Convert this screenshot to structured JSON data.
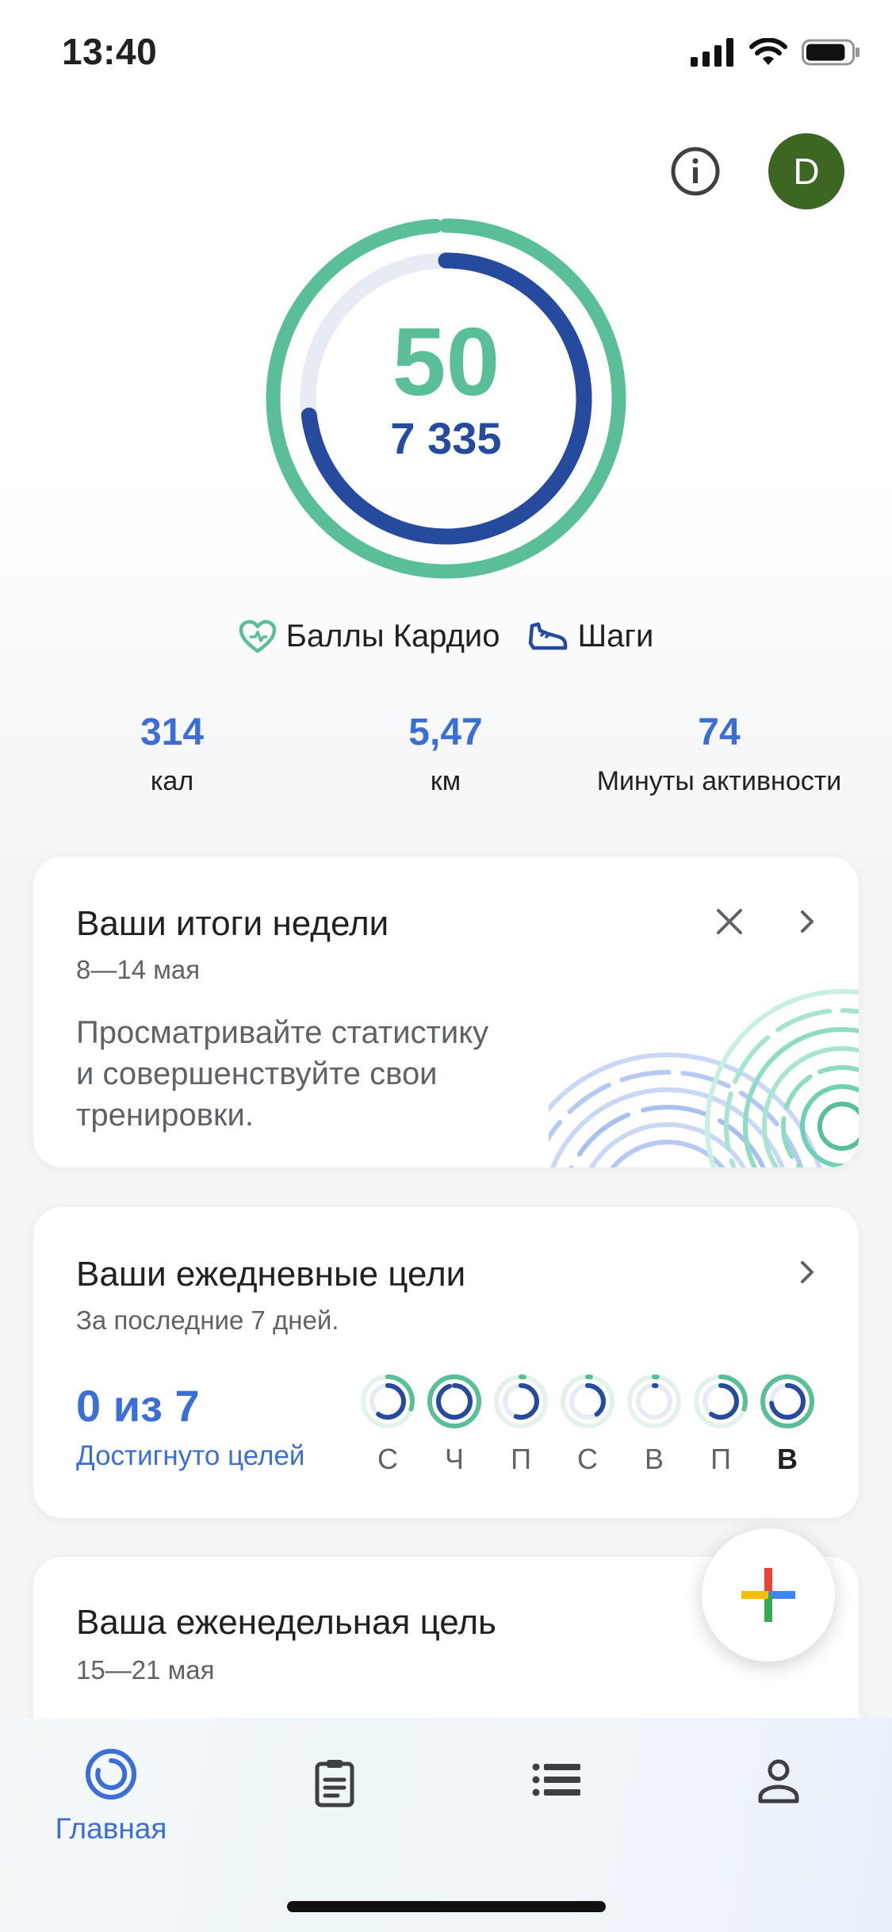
{
  "status_bar": {
    "time": "13:40",
    "battery_level": 0.85
  },
  "header": {
    "avatar_letter": "D"
  },
  "summary": {
    "cardio_points": "50",
    "steps": "7 335",
    "cardio_goal_fraction": 0.99,
    "steps_goal_fraction": 0.73,
    "legend": {
      "cardio_label": "Баллы Кардио",
      "steps_label": "Шаги"
    }
  },
  "stats": [
    {
      "value": "314",
      "label": "кал"
    },
    {
      "value": "5,47",
      "label": "км"
    },
    {
      "value": "74",
      "label": "Минуты активности"
    }
  ],
  "weekly_summary_card": {
    "title": "Ваши итоги недели",
    "date_range": "8—14 мая",
    "body_lines": [
      "Просматривайте статистику",
      "и совершенствуйте свои",
      "тренировки."
    ]
  },
  "daily_goals_card": {
    "title": "Ваши ежедневные цели",
    "subtitle": "За последние 7 дней.",
    "goals_count": "0 из 7",
    "goals_caption": "Достигнуто целей",
    "days": [
      {
        "label": "С",
        "cardio": 0.3,
        "steps": 0.6
      },
      {
        "label": "Ч",
        "cardio": 1.0,
        "steps": 0.95
      },
      {
        "label": "П",
        "cardio": 0.02,
        "steps": 0.55
      },
      {
        "label": "С",
        "cardio": 0.02,
        "steps": 0.4
      },
      {
        "label": "В",
        "cardio": 0.02,
        "steps": 0.02
      },
      {
        "label": "П",
        "cardio": 0.3,
        "steps": 0.6
      },
      {
        "label": "В",
        "cardio": 1.0,
        "steps": 0.73
      }
    ]
  },
  "weekly_goal_card": {
    "title": "Ваша еженедельная цель",
    "date_range": "15—21 мая"
  },
  "nav": {
    "home_label": "Главная",
    "colors": {
      "accent": "#3b6fd6",
      "cardio": "#5abf98",
      "steps": "#254a9e",
      "avatar": "#3d6622"
    }
  }
}
